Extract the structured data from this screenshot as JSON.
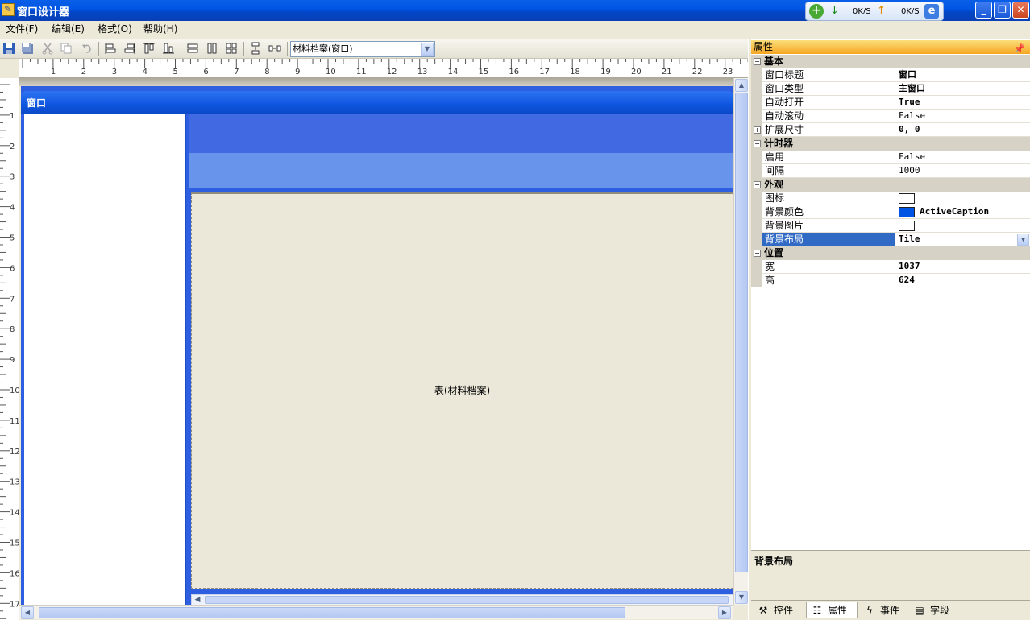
{
  "window": {
    "title": "窗口设计器"
  },
  "net_widget": {
    "down_speed": "0K/S",
    "up_speed": "0K/S"
  },
  "menu": [
    {
      "label": "文件(F)"
    },
    {
      "label": "编辑(E)"
    },
    {
      "label": "格式(O)"
    },
    {
      "label": "帮助(H)"
    }
  ],
  "toolbar": {
    "object_select": "材料档案(窗口)"
  },
  "ruler": {
    "horizontal": [
      "1",
      "2",
      "3",
      "4",
      "5",
      "6",
      "7",
      "8",
      "9",
      "10",
      "11",
      "12",
      "13",
      "14",
      "15",
      "16",
      "17",
      "18",
      "19",
      "20",
      "21",
      "22",
      "23"
    ],
    "vertical": [
      "1",
      "2",
      "3",
      "4",
      "5",
      "6",
      "7",
      "8",
      "9",
      "10",
      "11",
      "12",
      "13",
      "14",
      "15",
      "16",
      "17"
    ]
  },
  "design": {
    "form_caption": "窗口",
    "table_label": "表(材料档案)"
  },
  "properties": {
    "header": "属性",
    "categories": [
      {
        "name": "基本",
        "rows": [
          {
            "name": "窗口标题",
            "value": "窗口",
            "bold": true
          },
          {
            "name": "窗口类型",
            "value": "主窗口",
            "bold": true
          },
          {
            "name": "自动打开",
            "value": "True",
            "bold": true
          },
          {
            "name": "自动滚动",
            "value": "False"
          },
          {
            "name": "扩展尺寸",
            "value": "0, 0",
            "bold": true,
            "expandable": true
          }
        ]
      },
      {
        "name": "计时器",
        "rows": [
          {
            "name": "启用",
            "value": "False"
          },
          {
            "name": "间隔",
            "value": "1000"
          }
        ]
      },
      {
        "name": "外观",
        "rows": [
          {
            "name": "图标",
            "value": "",
            "swatch": "#FFFFFF"
          },
          {
            "name": "背景颜色",
            "value": "ActiveCaption",
            "bold": true,
            "swatch": "#0054E3"
          },
          {
            "name": "背景图片",
            "value": "",
            "swatch": "#FFFFFF"
          },
          {
            "name": "背景布局",
            "value": "Tile",
            "bold": true,
            "selected": true,
            "dropdown": true
          }
        ]
      },
      {
        "name": "位置",
        "rows": [
          {
            "name": "宽",
            "value": "1037",
            "bold": true
          },
          {
            "name": "高",
            "value": "624",
            "bold": true
          }
        ]
      }
    ],
    "description_title": "背景布局",
    "tabs": [
      {
        "label": "控件",
        "icon": "tools-icon"
      },
      {
        "label": "属性",
        "icon": "properties-icon",
        "active": true
      },
      {
        "label": "事件",
        "icon": "lightning-icon"
      },
      {
        "label": "字段",
        "icon": "fields-icon"
      }
    ]
  }
}
